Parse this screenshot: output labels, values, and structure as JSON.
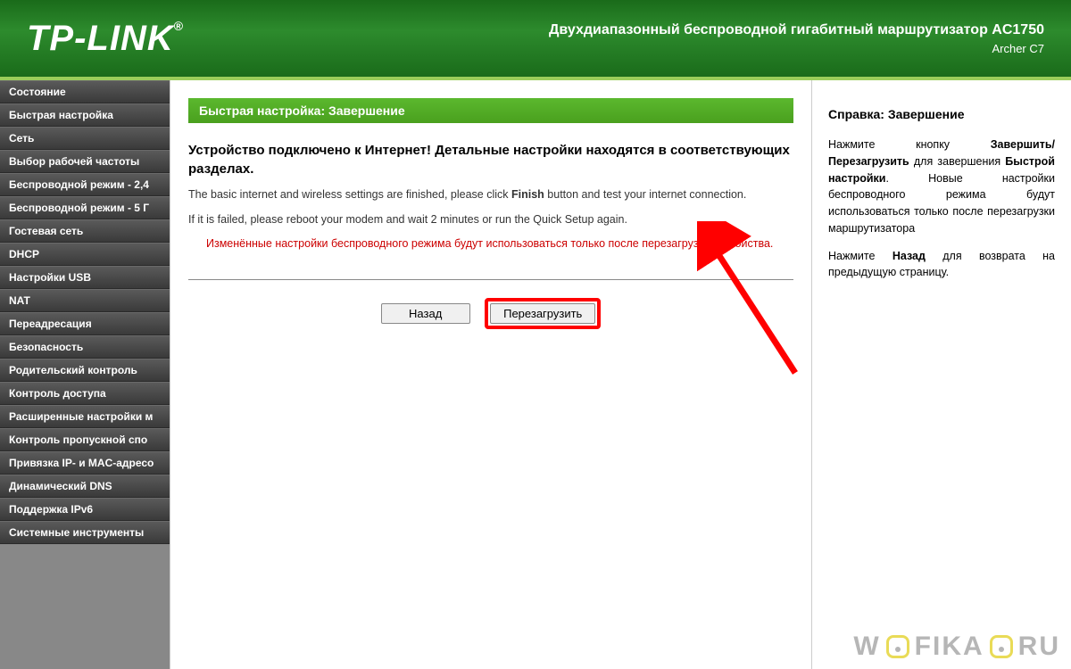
{
  "header": {
    "brand": "TP-LINK",
    "product_title": "Двухдиапазонный беспроводной гигабитный маршрутизатор AC1750",
    "product_model": "Archer C7"
  },
  "sidebar": {
    "items": [
      "Состояние",
      "Быстрая настройка",
      "Сеть",
      "Выбор рабочей частоты",
      "Беспроводной режим - 2,4",
      "Беспроводной режим - 5 Г",
      "Гостевая сеть",
      "DHCP",
      "Настройки USB",
      "NAT",
      "Переадресация",
      "Безопасность",
      "Родительский контроль",
      "Контроль доступа",
      "Расширенные настройки м",
      "Контроль пропускной спо",
      "Привязка IP- и MAC-адресо",
      "Динамический DNS",
      "Поддержка IPv6",
      "Системные инструменты"
    ]
  },
  "main": {
    "section_header": "Быстрая настройка: Завершение",
    "title": "Устройство подключено к Интернет! Детальные настройки находятся в соответствующих разделах.",
    "text1_pre": "The basic internet and wireless settings are finished, please click ",
    "text1_bold": "Finish",
    "text1_post": " button and test your internet connection.",
    "text2": "If it is failed, please reboot your modem and wait 2 minutes or run the Quick Setup again.",
    "warning": "Изменённые настройки беспроводного режима будут использоваться только после перезагрузки устройства.",
    "btn_back": "Назад",
    "btn_reboot": "Перезагрузить"
  },
  "help": {
    "title": "Справка: Завершение",
    "p1_pre": "Нажмите кнопку ",
    "p1_b1": "Завершить/Перезагрузить",
    "p1_mid": " для завершения ",
    "p1_b2": "Быстрой настройки",
    "p1_post": ". Новые настройки беспроводного режима будут использоваться только после перезагрузки маршрутизатора",
    "p2_pre": "Нажмите ",
    "p2_b": "Назад",
    "p2_post": " для возврата на предыдущую страницу."
  },
  "watermark": {
    "t1": "W",
    "t2": "FIKA",
    "t3": "RU"
  }
}
